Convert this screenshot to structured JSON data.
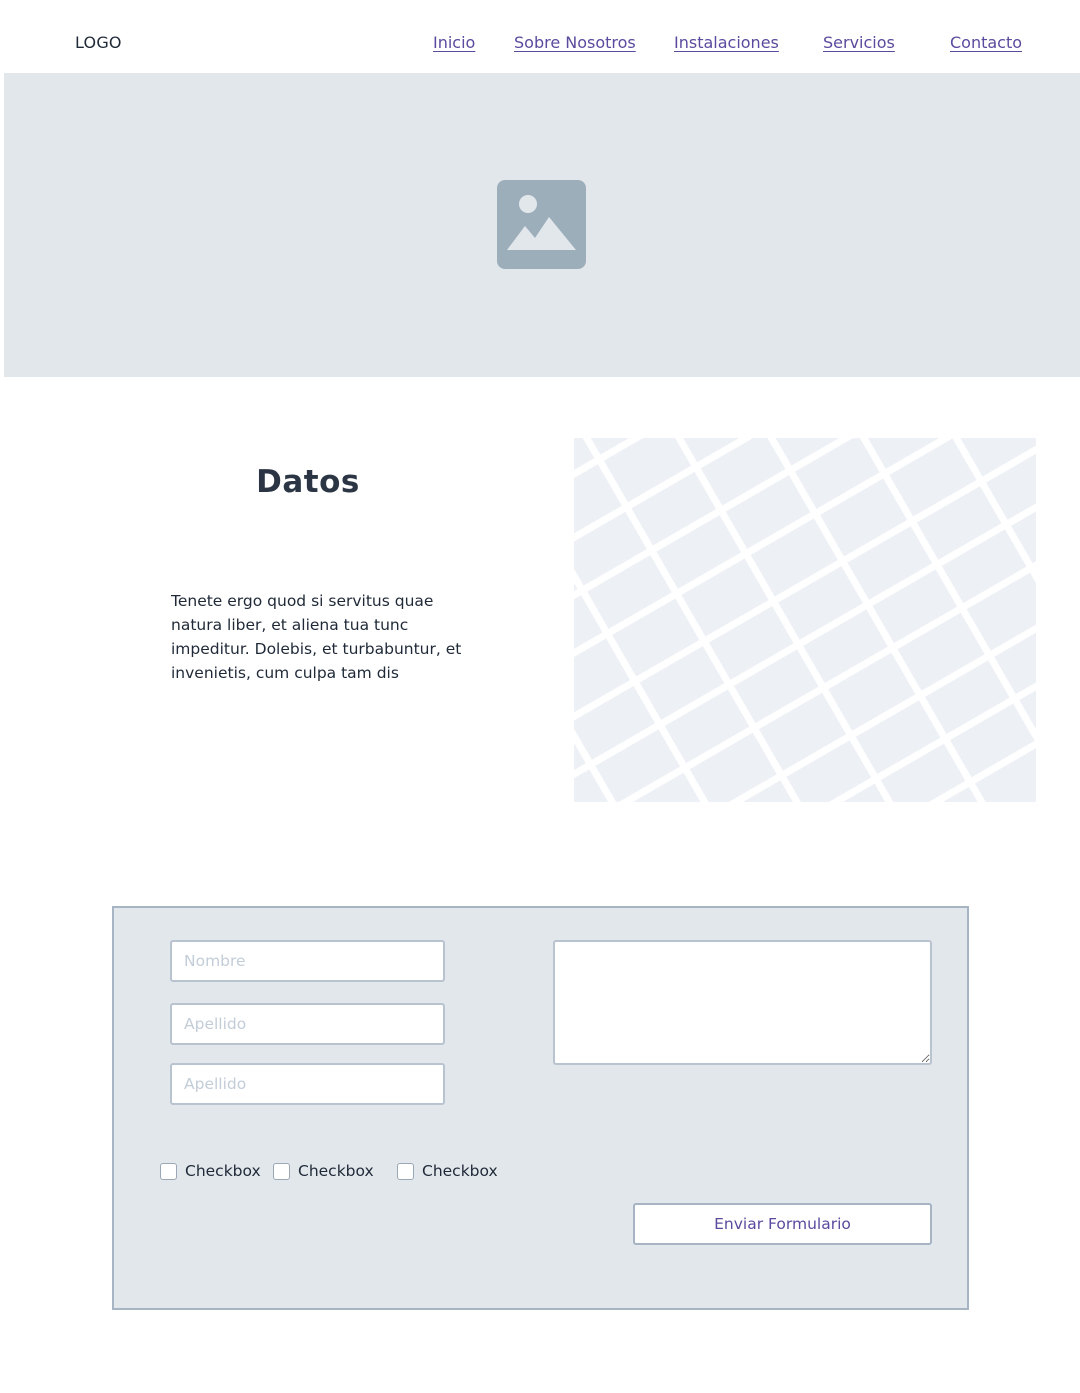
{
  "header": {
    "logo": "LOGO",
    "nav": [
      "Inicio",
      "Sobre Nosotros",
      "Instalaciones",
      "Servicios",
      "Contacto"
    ]
  },
  "hero": {
    "icon": "image-placeholder-icon"
  },
  "datos": {
    "title": "Datos",
    "text": "Tenete ergo quod si servitus quae natura liber, et aliena tua tunc impeditur. Dolebis, et turbabuntur, et invenietis, cum culpa tam dis"
  },
  "map": {
    "icon": "map-placeholder"
  },
  "form": {
    "fields": [
      {
        "value": "",
        "placeholder": "Nombre"
      },
      {
        "value": "",
        "placeholder": "Apellido"
      },
      {
        "value": "",
        "placeholder": "Apellido"
      }
    ],
    "message": {
      "value": ""
    },
    "checkboxes": [
      {
        "label": "Checkbox",
        "checked": false
      },
      {
        "label": "Checkbox",
        "checked": false
      },
      {
        "label": "Checkbox",
        "checked": false
      }
    ],
    "submit_label": "Enviar Formulario"
  },
  "colors": {
    "accent": "#5b4a9e",
    "panel_bg": "#e2e7ec",
    "border": "#a6b4c3",
    "placeholder_icon": "#9daebb"
  }
}
